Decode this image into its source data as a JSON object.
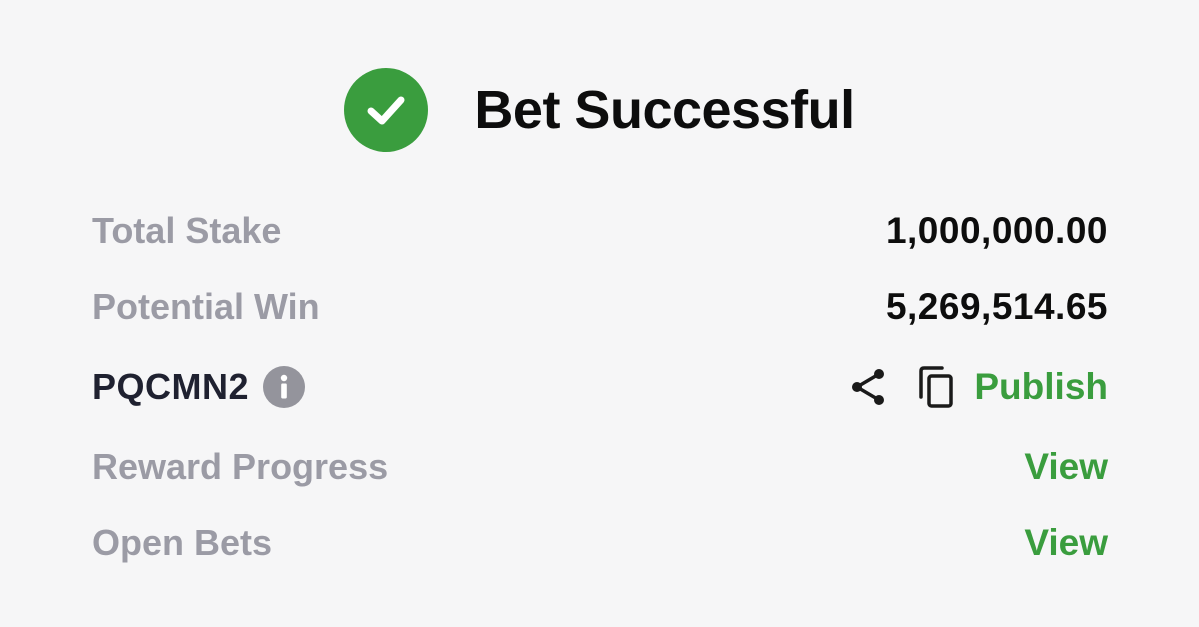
{
  "header": {
    "title": "Bet Successful",
    "icon": "check-circle-icon",
    "accent": "#3a9d3e"
  },
  "rows": {
    "total_stake": {
      "label": "Total Stake",
      "value": "1,000,000.00"
    },
    "potential_win": {
      "label": "Potential Win",
      "value": "5,269,514.65"
    },
    "booking": {
      "code": "PQCMN2",
      "info_icon": "info-icon",
      "share_icon": "share-icon",
      "copy_icon": "copy-icon",
      "publish_label": "Publish"
    },
    "reward_progress": {
      "label": "Reward Progress",
      "link": "View"
    },
    "open_bets": {
      "label": "Open Bets",
      "link": "View"
    }
  },
  "colors": {
    "background": "#f6f6f7",
    "label": "#9b9ba5",
    "value": "#0d0d0d",
    "link": "#3a9d3e"
  }
}
